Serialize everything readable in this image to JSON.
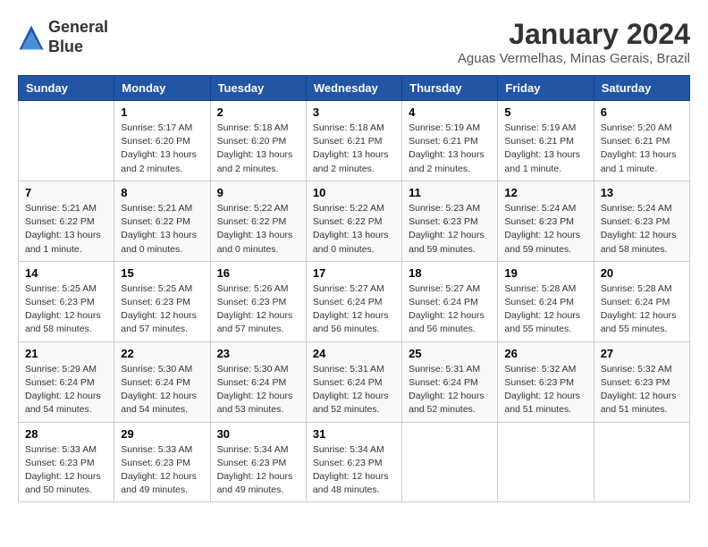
{
  "logo": {
    "line1": "General",
    "line2": "Blue"
  },
  "title": "January 2024",
  "subtitle": "Aguas Vermelhas, Minas Gerais, Brazil",
  "days_of_week": [
    "Sunday",
    "Monday",
    "Tuesday",
    "Wednesday",
    "Thursday",
    "Friday",
    "Saturday"
  ],
  "weeks": [
    [
      {
        "day": "",
        "info": ""
      },
      {
        "day": "1",
        "info": "Sunrise: 5:17 AM\nSunset: 6:20 PM\nDaylight: 13 hours\nand 2 minutes."
      },
      {
        "day": "2",
        "info": "Sunrise: 5:18 AM\nSunset: 6:20 PM\nDaylight: 13 hours\nand 2 minutes."
      },
      {
        "day": "3",
        "info": "Sunrise: 5:18 AM\nSunset: 6:21 PM\nDaylight: 13 hours\nand 2 minutes."
      },
      {
        "day": "4",
        "info": "Sunrise: 5:19 AM\nSunset: 6:21 PM\nDaylight: 13 hours\nand 2 minutes."
      },
      {
        "day": "5",
        "info": "Sunrise: 5:19 AM\nSunset: 6:21 PM\nDaylight: 13 hours\nand 1 minute."
      },
      {
        "day": "6",
        "info": "Sunrise: 5:20 AM\nSunset: 6:21 PM\nDaylight: 13 hours\nand 1 minute."
      }
    ],
    [
      {
        "day": "7",
        "info": "Sunrise: 5:21 AM\nSunset: 6:22 PM\nDaylight: 13 hours\nand 1 minute."
      },
      {
        "day": "8",
        "info": "Sunrise: 5:21 AM\nSunset: 6:22 PM\nDaylight: 13 hours\nand 0 minutes."
      },
      {
        "day": "9",
        "info": "Sunrise: 5:22 AM\nSunset: 6:22 PM\nDaylight: 13 hours\nand 0 minutes."
      },
      {
        "day": "10",
        "info": "Sunrise: 5:22 AM\nSunset: 6:22 PM\nDaylight: 13 hours\nand 0 minutes."
      },
      {
        "day": "11",
        "info": "Sunrise: 5:23 AM\nSunset: 6:23 PM\nDaylight: 12 hours\nand 59 minutes."
      },
      {
        "day": "12",
        "info": "Sunrise: 5:24 AM\nSunset: 6:23 PM\nDaylight: 12 hours\nand 59 minutes."
      },
      {
        "day": "13",
        "info": "Sunrise: 5:24 AM\nSunset: 6:23 PM\nDaylight: 12 hours\nand 58 minutes."
      }
    ],
    [
      {
        "day": "14",
        "info": "Sunrise: 5:25 AM\nSunset: 6:23 PM\nDaylight: 12 hours\nand 58 minutes."
      },
      {
        "day": "15",
        "info": "Sunrise: 5:25 AM\nSunset: 6:23 PM\nDaylight: 12 hours\nand 57 minutes."
      },
      {
        "day": "16",
        "info": "Sunrise: 5:26 AM\nSunset: 6:23 PM\nDaylight: 12 hours\nand 57 minutes."
      },
      {
        "day": "17",
        "info": "Sunrise: 5:27 AM\nSunset: 6:24 PM\nDaylight: 12 hours\nand 56 minutes."
      },
      {
        "day": "18",
        "info": "Sunrise: 5:27 AM\nSunset: 6:24 PM\nDaylight: 12 hours\nand 56 minutes."
      },
      {
        "day": "19",
        "info": "Sunrise: 5:28 AM\nSunset: 6:24 PM\nDaylight: 12 hours\nand 55 minutes."
      },
      {
        "day": "20",
        "info": "Sunrise: 5:28 AM\nSunset: 6:24 PM\nDaylight: 12 hours\nand 55 minutes."
      }
    ],
    [
      {
        "day": "21",
        "info": "Sunrise: 5:29 AM\nSunset: 6:24 PM\nDaylight: 12 hours\nand 54 minutes."
      },
      {
        "day": "22",
        "info": "Sunrise: 5:30 AM\nSunset: 6:24 PM\nDaylight: 12 hours\nand 54 minutes."
      },
      {
        "day": "23",
        "info": "Sunrise: 5:30 AM\nSunset: 6:24 PM\nDaylight: 12 hours\nand 53 minutes."
      },
      {
        "day": "24",
        "info": "Sunrise: 5:31 AM\nSunset: 6:24 PM\nDaylight: 12 hours\nand 52 minutes."
      },
      {
        "day": "25",
        "info": "Sunrise: 5:31 AM\nSunset: 6:24 PM\nDaylight: 12 hours\nand 52 minutes."
      },
      {
        "day": "26",
        "info": "Sunrise: 5:32 AM\nSunset: 6:23 PM\nDaylight: 12 hours\nand 51 minutes."
      },
      {
        "day": "27",
        "info": "Sunrise: 5:32 AM\nSunset: 6:23 PM\nDaylight: 12 hours\nand 51 minutes."
      }
    ],
    [
      {
        "day": "28",
        "info": "Sunrise: 5:33 AM\nSunset: 6:23 PM\nDaylight: 12 hours\nand 50 minutes."
      },
      {
        "day": "29",
        "info": "Sunrise: 5:33 AM\nSunset: 6:23 PM\nDaylight: 12 hours\nand 49 minutes."
      },
      {
        "day": "30",
        "info": "Sunrise: 5:34 AM\nSunset: 6:23 PM\nDaylight: 12 hours\nand 49 minutes."
      },
      {
        "day": "31",
        "info": "Sunrise: 5:34 AM\nSunset: 6:23 PM\nDaylight: 12 hours\nand 48 minutes."
      },
      {
        "day": "",
        "info": ""
      },
      {
        "day": "",
        "info": ""
      },
      {
        "day": "",
        "info": ""
      }
    ]
  ]
}
